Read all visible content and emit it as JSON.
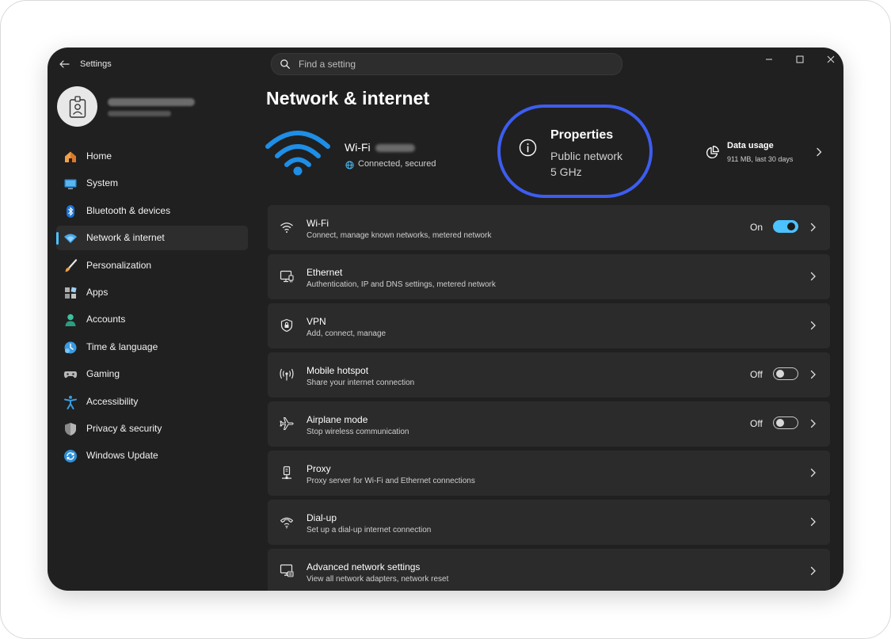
{
  "window": {
    "app_title": "Settings",
    "search_placeholder": "Find a setting"
  },
  "sidebar": {
    "items": [
      {
        "label": "Home",
        "icon": "home-icon"
      },
      {
        "label": "System",
        "icon": "system-icon"
      },
      {
        "label": "Bluetooth & devices",
        "icon": "bluetooth-icon"
      },
      {
        "label": "Network & internet",
        "icon": "network-icon",
        "active": true
      },
      {
        "label": "Personalization",
        "icon": "brush-icon"
      },
      {
        "label": "Apps",
        "icon": "apps-icon"
      },
      {
        "label": "Accounts",
        "icon": "accounts-icon"
      },
      {
        "label": "Time & language",
        "icon": "time-language-icon"
      },
      {
        "label": "Gaming",
        "icon": "gaming-icon"
      },
      {
        "label": "Accessibility",
        "icon": "accessibility-icon"
      },
      {
        "label": "Privacy & security",
        "icon": "shield-icon"
      },
      {
        "label": "Windows Update",
        "icon": "update-icon"
      }
    ]
  },
  "main": {
    "title": "Network & internet",
    "connection": {
      "name": "Wi-Fi",
      "status": "Connected, secured"
    },
    "properties": {
      "title": "Properties",
      "network": "Public network",
      "band": "5 GHz"
    },
    "data_usage": {
      "title": "Data usage",
      "subtitle": "911 MB, last 30 days"
    },
    "rows": [
      {
        "title": "Wi-Fi",
        "subtitle": "Connect, manage known networks, metered network",
        "icon": "wifi-icon",
        "toggle": "On"
      },
      {
        "title": "Ethernet",
        "subtitle": "Authentication, IP and DNS settings, metered network",
        "icon": "ethernet-icon"
      },
      {
        "title": "VPN",
        "subtitle": "Add, connect, manage",
        "icon": "vpn-shield-icon"
      },
      {
        "title": "Mobile hotspot",
        "subtitle": "Share your internet connection",
        "icon": "hotspot-icon",
        "toggle": "Off"
      },
      {
        "title": "Airplane mode",
        "subtitle": "Stop wireless communication",
        "icon": "airplane-icon",
        "toggle": "Off"
      },
      {
        "title": "Proxy",
        "subtitle": "Proxy server for Wi-Fi and Ethernet connections",
        "icon": "proxy-icon"
      },
      {
        "title": "Dial-up",
        "subtitle": "Set up a dial-up internet connection",
        "icon": "dialup-icon"
      },
      {
        "title": "Advanced network settings",
        "subtitle": "View all network adapters, network reset",
        "icon": "advanced-network-icon"
      }
    ]
  },
  "colors": {
    "accent": "#4cc2ff",
    "highlight_ring": "#3d5df0",
    "window_bg": "#202020",
    "card_bg": "#2b2b2b"
  }
}
